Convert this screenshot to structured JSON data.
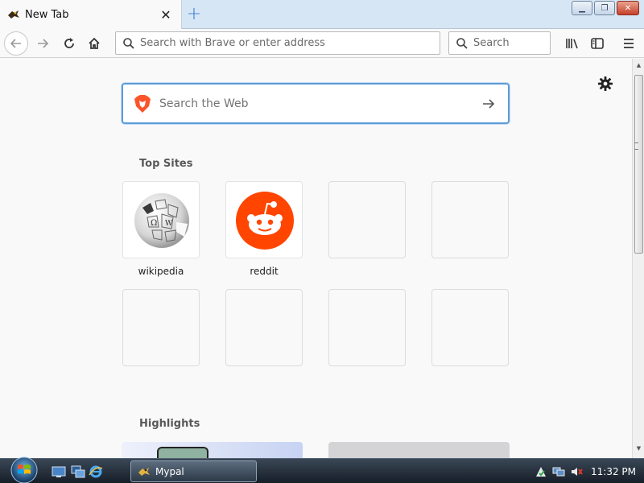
{
  "tab": {
    "title": "New Tab",
    "close_symbol": "✕",
    "new_tab_symbol": "+"
  },
  "window_controls": {
    "minimize": "▁",
    "maximize": "❐",
    "close": "✕"
  },
  "toolbar": {
    "urlbar_placeholder": "Search with Brave or enter address",
    "searchbar_placeholder": "Search"
  },
  "newtab": {
    "websearch_placeholder": "Search the Web",
    "top_sites_title": "Top Sites",
    "highlights_title": "Highlights",
    "top_sites": [
      {
        "label": "wikipedia",
        "icon": "wikipedia-globe-icon"
      },
      {
        "label": "reddit",
        "icon": "reddit-snoo-icon"
      },
      {
        "label": "",
        "icon": ""
      },
      {
        "label": "",
        "icon": ""
      },
      {
        "label": "",
        "icon": ""
      },
      {
        "label": "",
        "icon": ""
      },
      {
        "label": "",
        "icon": ""
      },
      {
        "label": "",
        "icon": ""
      }
    ]
  },
  "taskbar": {
    "task_label": "Mypal",
    "clock": "11:32 PM"
  },
  "colors": {
    "accent": "#5e9cd8",
    "reddit": "#ff4500",
    "brave": "#fb542b"
  }
}
